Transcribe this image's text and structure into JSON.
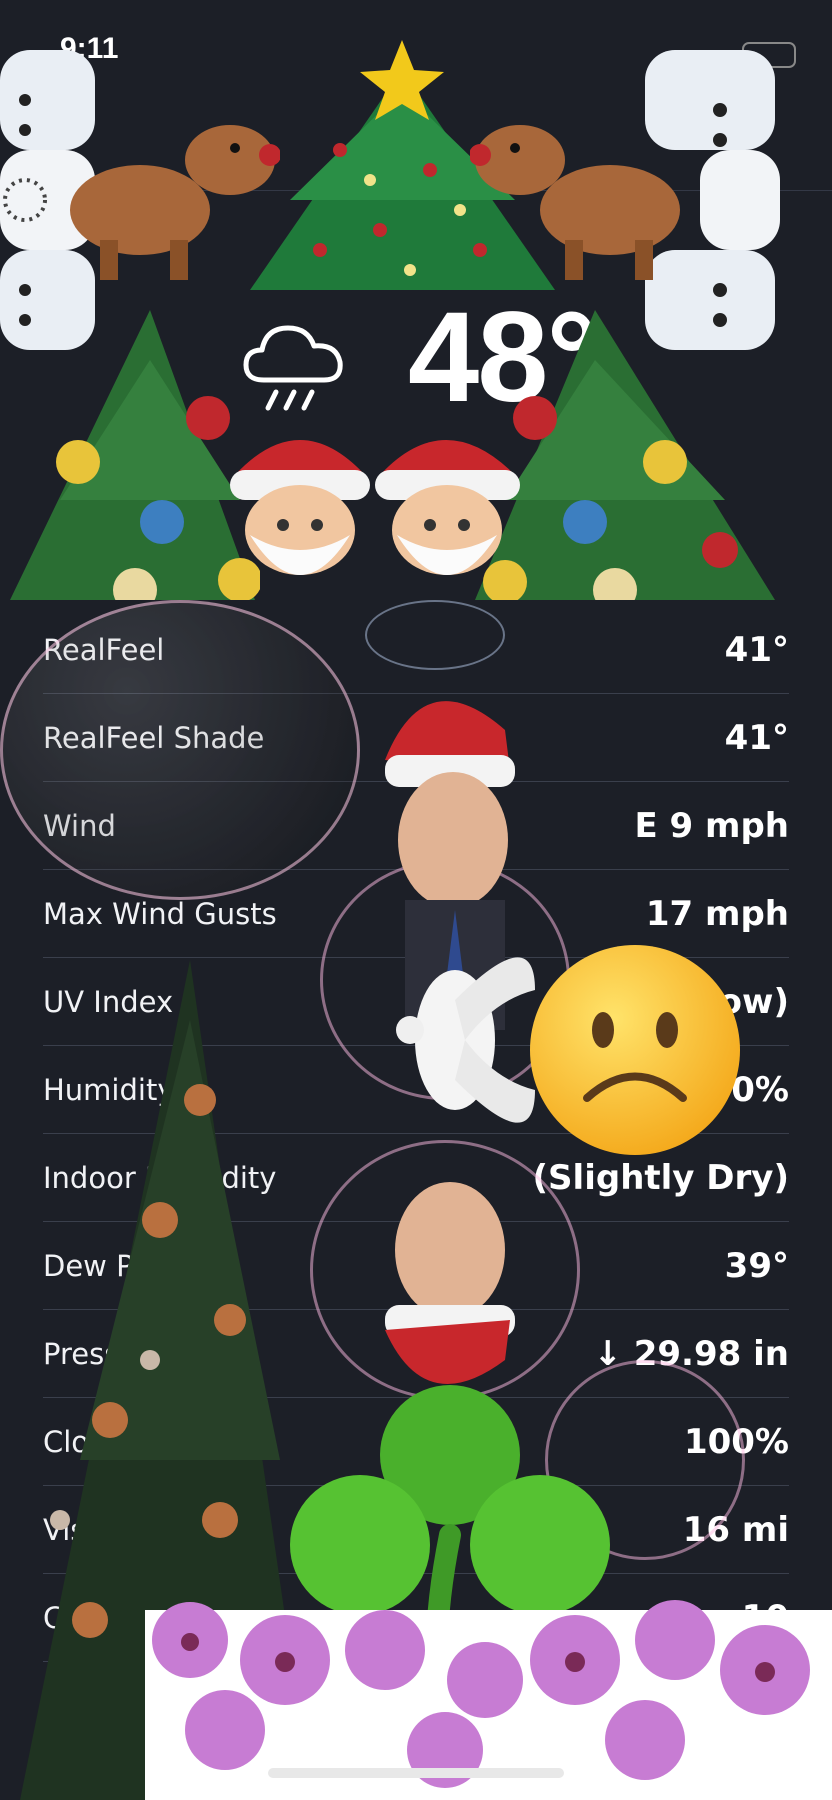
{
  "status_bar": {
    "time": "9:11"
  },
  "current": {
    "temperature": "48°",
    "condition_icon": "rain-cloud-icon"
  },
  "details": [
    {
      "label": "RealFeel",
      "value": "41°"
    },
    {
      "label": "RealFeel Shade",
      "value": "41°"
    },
    {
      "label": "Wind",
      "value": "E 9 mph"
    },
    {
      "label": "Max Wind Gusts",
      "value": "17 mph"
    },
    {
      "label": "UV Index",
      "value": "0 (Low)"
    },
    {
      "label": "Humidity",
      "value": "90%"
    },
    {
      "label": "Indoor Humidity",
      "value": "(Slightly Dry)"
    },
    {
      "label": "Dew Point",
      "value": "39°"
    },
    {
      "label": "Pressure",
      "value": "↓ 29.98 in"
    },
    {
      "label": "Cloud Cover",
      "value": "100%"
    },
    {
      "label": "Visibility",
      "value": "16 mi"
    },
    {
      "label": "Cloud Ceiling",
      "value": "10"
    }
  ],
  "stickers": [
    "snowman-sticker",
    "reindeer-sticker",
    "christmas-tree-sticker",
    "santa-sticker",
    "bubble-sticker",
    "person-with-santa-hat-sticker",
    "dove-sticker",
    "frowning-face-sticker",
    "decorated-tree-sticker",
    "shamrock-sticker",
    "orchid-sticker"
  ]
}
